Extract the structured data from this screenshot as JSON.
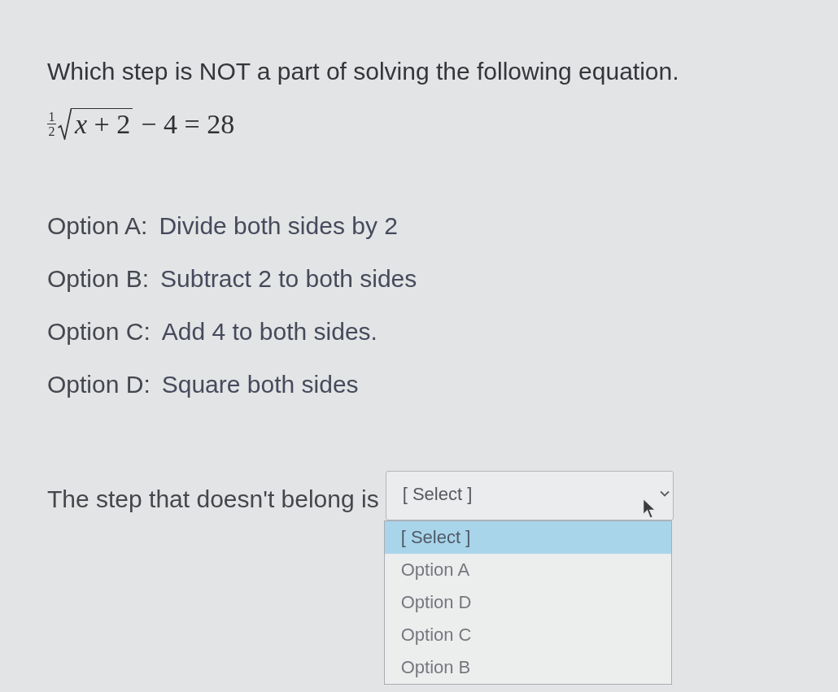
{
  "question": {
    "text": "Which step is NOT a part of solving the following equation."
  },
  "equation": {
    "numerator": "1",
    "denominator": "2",
    "radicand": "*x* + 2",
    "rest": "− 4 = 28"
  },
  "options": [
    {
      "label": "Option A:",
      "text": "Divide both sides by 2"
    },
    {
      "label": "Option B:",
      "text": "Subtract 2 to both sides"
    },
    {
      "label": "Option C:",
      "text": "Add 4 to both sides."
    },
    {
      "label": "Option D:",
      "text": "Square both sides"
    }
  ],
  "answer": {
    "prompt": "The step that doesn't belong is",
    "dropdown": {
      "value": "[ Select ]",
      "expanded": true,
      "items": [
        {
          "label": "[ Select ]",
          "selected": true
        },
        {
          "label": "Option A",
          "selected": false
        },
        {
          "label": "Option D",
          "selected": false
        },
        {
          "label": "Option C",
          "selected": false
        },
        {
          "label": "Option B",
          "selected": false
        }
      ]
    }
  }
}
